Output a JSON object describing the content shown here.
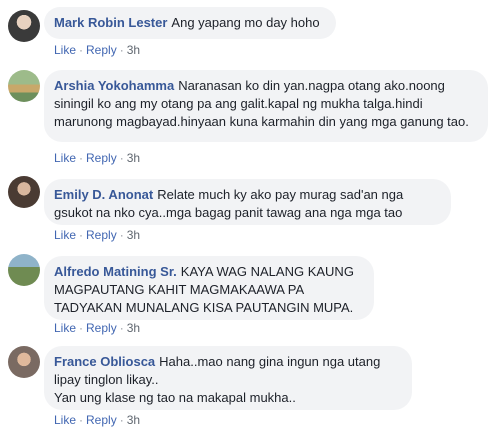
{
  "comments": [
    {
      "author": "Mark Robin Lester",
      "text": "Ang yapang mo day hoho",
      "like_label": "Like",
      "reply_label": "Reply",
      "time": "3h"
    },
    {
      "author": "Arshia Yokohamma",
      "text": "Naranasan ko din yan.nagpa otang ako.noong siningil ko ang my otang pa ang galit.kapal ng mukha talga.hindi marunong magbayad.hinyaan kuna karmahin din yang mga ganung tao.",
      "like_label": "Like",
      "reply_label": "Reply",
      "time": "3h"
    },
    {
      "author": "Emily D. Anonat",
      "text": "Relate much ky ako pay murag sad'an nga gsukot na nko cya..mga bagag panit tawag ana nga mga tao",
      "like_label": "Like",
      "reply_label": "Reply",
      "time": "3h"
    },
    {
      "author": "Alfredo Matining Sr.",
      "text": "KAYA WAG NALANG KAUNG MAGPAUTANG KAHIT MAGMAKAAWA PA TADYAKAN MUNALANG KISA PAUTANGIN MUPA.",
      "like_label": "Like",
      "reply_label": "Reply",
      "time": "3h"
    },
    {
      "author": "France Obliosca",
      "text": "Haha..mao nang gina ingun nga utang lipay tinglon likay..\nYan ung klase ng tao na makapal mukha..",
      "like_label": "Like",
      "reply_label": "Reply",
      "time": "3h"
    }
  ],
  "colors": {
    "author": "#385898",
    "link": "#4267b2",
    "bubble": "#f2f3f5",
    "meta": "#90949c"
  }
}
